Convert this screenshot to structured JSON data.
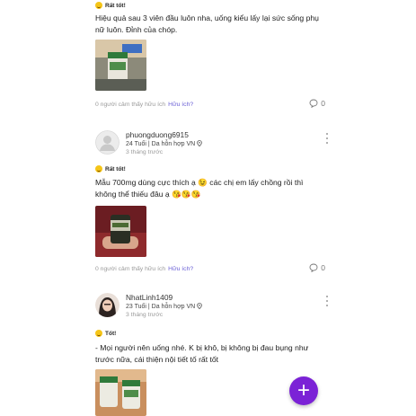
{
  "reviews": [
    {
      "rating_label": "Rất tốt!",
      "text": "Hiệu quả sau 3 viên đầu luôn nha, uống kiểu lấy lại sức sống phụ nữ luôn. Đỉnh của chóp.",
      "helpful_text": "0 người cảm thấy hữu ích",
      "helpful_link": "Hữu ích?",
      "comment_count": "0"
    },
    {
      "user_name": "phuongduong6915",
      "user_meta": "24 Tuổi | Da hỗn hợp VN",
      "time": "3 tháng trước",
      "rating_label": "Rất tốt!",
      "text": "Mẫu 700mg dùng cực thích ạ 😉 các chị em lấy chồng rồi thì không thể thiếu đâu ạ 😘😘😘",
      "helpful_text": "0 người cảm thấy hữu ích",
      "helpful_link": "Hữu ích?",
      "comment_count": "0"
    },
    {
      "user_name": "NhatLinh1409",
      "user_meta": "23 Tuổi | Da hỗn hợp VN",
      "time": "3 tháng trước",
      "rating_label": "Tốt!",
      "text": "- Mọi người nên uống nhé. K bị khô, bị không bị đau bụng như trước nữa, cái thiện nội tiết tố rất tốt"
    }
  ],
  "fab_label": "+",
  "colors": {
    "accent": "#6a5fd6",
    "fab": "#7b22d6",
    "rating_emoji": "#f5c518"
  }
}
